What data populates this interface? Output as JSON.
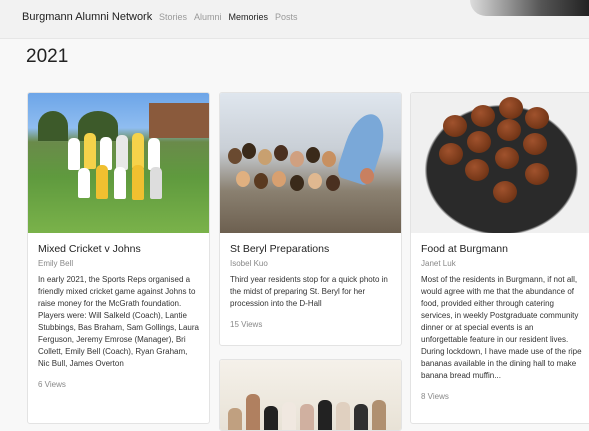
{
  "header": {
    "brand": "Burgmann Alumni Network",
    "nav": [
      {
        "label": "Stories",
        "active": false
      },
      {
        "label": "Alumni",
        "active": false
      },
      {
        "label": "Memories",
        "active": true
      },
      {
        "label": "Posts",
        "active": false
      }
    ]
  },
  "page": {
    "year": "2021"
  },
  "cards": [
    {
      "title": "Mixed Cricket v Johns",
      "author": "Emily Bell",
      "text": "In early 2021, the Sports Reps organised a friendly mixed cricket game against Johns to raise money for the McGrath foundation. Players were: Will Salkeld (Coach), Lantie Stubbings, Bas Braham, Sam Gollings, Laura Ferguson, Jeremy Emrose (Manager), Bri Collett, Emily Bell (Coach), Ryan Graham, Nic Bull, James Overton",
      "views": "6 Views"
    },
    {
      "title": "St Beryl Preparations",
      "author": "Isobel Kuo",
      "text": "Third year residents stop for a quick photo in the midst of preparing St. Beryl for her procession into the D-Hall",
      "views": "15 Views"
    },
    {
      "title": "Food at Burgmann",
      "author": "Janet Luk",
      "text": "Most of the residents in Burgmann, if not all, would agree with me that the abundance of food, provided either through catering services, in weekly Postgraduate community dinner or at special events is an unforgettable feature in our resident lives. During lockdown, I have made use of the ripe bananas available in the dining hall to make banana bread muffin...",
      "views": "8 Views"
    }
  ]
}
